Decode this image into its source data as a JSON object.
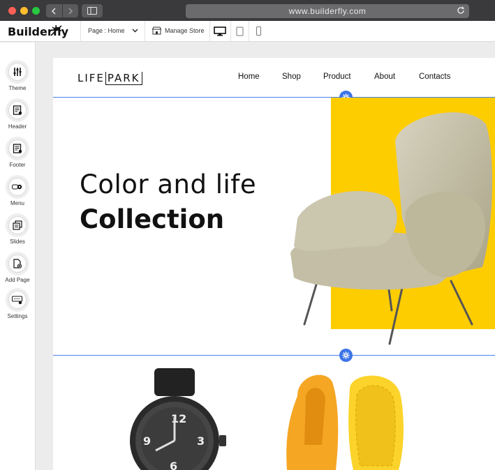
{
  "browser": {
    "url": "www.builderfly.com"
  },
  "app": {
    "logo": "Builderfly",
    "page_select": "Page : Home",
    "manage_store": "Manage Store",
    "devices": [
      "desktop-icon",
      "tablet-icon",
      "mobile-icon"
    ]
  },
  "tools": [
    {
      "label": "Theme",
      "icon": "sliders-icon"
    },
    {
      "label": "Header",
      "icon": "header-doc-icon"
    },
    {
      "label": "Footer",
      "icon": "footer-doc-icon"
    },
    {
      "label": "Menu",
      "icon": "menu-gear-icon"
    },
    {
      "label": "Slides",
      "icon": "slides-icon"
    },
    {
      "label": "Add Page",
      "icon": "add-page-icon"
    },
    {
      "label": "Settings",
      "icon": "settings-keyboard-icon"
    }
  ],
  "site": {
    "logo_part1": "LIFE",
    "logo_part2": "PARK",
    "nav": [
      "Home",
      "Shop",
      "Product",
      "About",
      "Contacts"
    ],
    "hero_line1": "Color and life",
    "hero_line2": "Collection"
  },
  "colors": {
    "accent_blue": "#3b74e8",
    "hero_yellow": "#fecd00"
  }
}
